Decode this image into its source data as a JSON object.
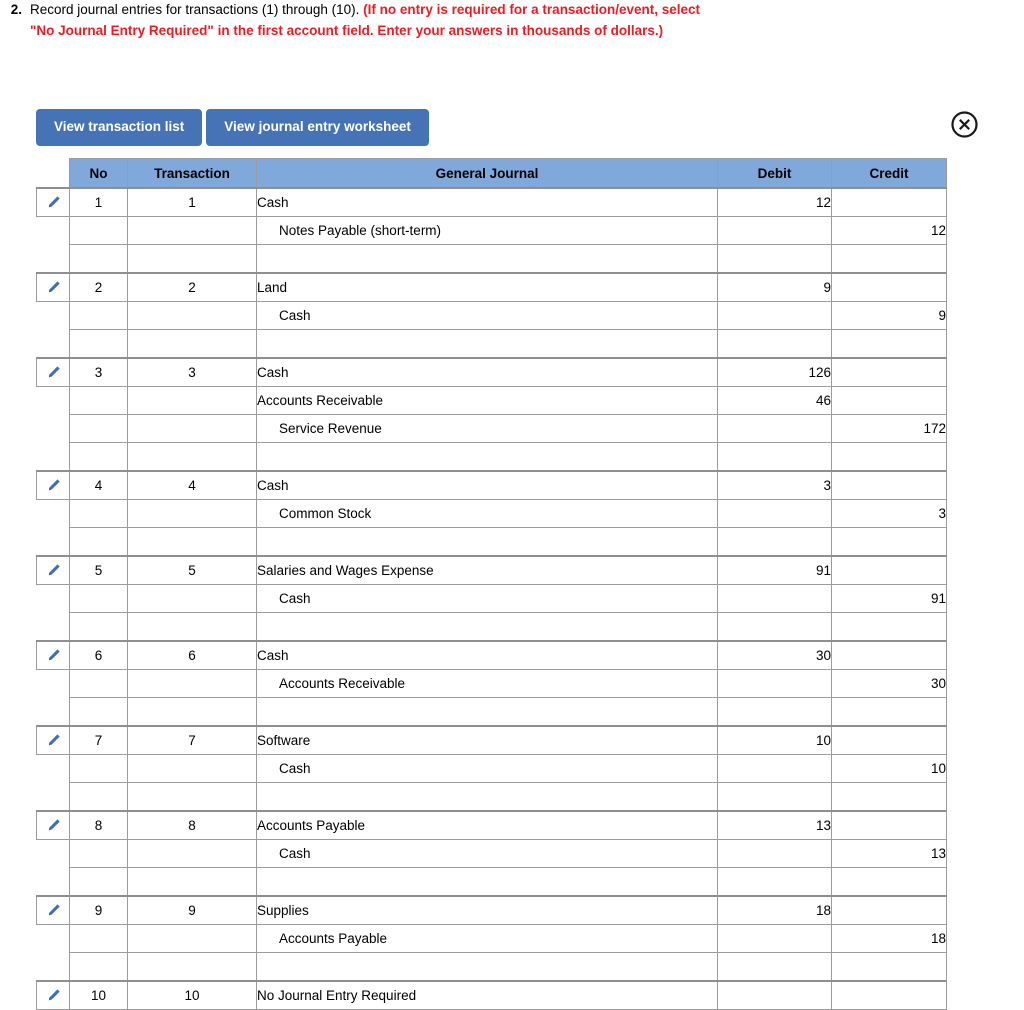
{
  "question": {
    "number": "2.",
    "lead": "Record journal entries for transactions (1) through (10). ",
    "emphasis": "(If no entry is required for a transaction/event, select \"No Journal Entry Required\" in the first account field. Enter your answers in thousands of dollars.)"
  },
  "toolbar": {
    "view_transaction_list_label": "View transaction list",
    "view_journal_entry_worksheet_label": "View journal entry worksheet",
    "close_icon": "close-circle-icon"
  },
  "colors": {
    "button_blue": "#4573b5",
    "header_blue": "#81a8db",
    "emphasis_red": "#ec1c24",
    "pencil_blue": "#3d6fb4",
    "grid_gray": "#9c9c9c"
  },
  "table": {
    "columns": [
      "No",
      "Transaction",
      "General Journal",
      "Debit",
      "Credit"
    ],
    "edit_icon": "pencil-icon",
    "entries": [
      {
        "no": "1",
        "transaction": "1",
        "lines": [
          {
            "account": "Cash",
            "indent": false,
            "debit": "12",
            "credit": ""
          },
          {
            "account": "Notes Payable (short-term)",
            "indent": true,
            "debit": "",
            "credit": "12"
          }
        ]
      },
      {
        "no": "2",
        "transaction": "2",
        "lines": [
          {
            "account": "Land",
            "indent": false,
            "debit": "9",
            "credit": ""
          },
          {
            "account": "Cash",
            "indent": true,
            "debit": "",
            "credit": "9"
          }
        ]
      },
      {
        "no": "3",
        "transaction": "3",
        "lines": [
          {
            "account": "Cash",
            "indent": false,
            "debit": "126",
            "credit": ""
          },
          {
            "account": "Accounts Receivable",
            "indent": false,
            "debit": "46",
            "credit": ""
          },
          {
            "account": "Service Revenue",
            "indent": true,
            "debit": "",
            "credit": "172"
          }
        ]
      },
      {
        "no": "4",
        "transaction": "4",
        "lines": [
          {
            "account": "Cash",
            "indent": false,
            "debit": "3",
            "credit": ""
          },
          {
            "account": "Common Stock",
            "indent": true,
            "debit": "",
            "credit": "3"
          }
        ]
      },
      {
        "no": "5",
        "transaction": "5",
        "lines": [
          {
            "account": "Salaries and Wages Expense",
            "indent": false,
            "debit": "91",
            "credit": ""
          },
          {
            "account": "Cash",
            "indent": true,
            "debit": "",
            "credit": "91"
          }
        ]
      },
      {
        "no": "6",
        "transaction": "6",
        "lines": [
          {
            "account": "Cash",
            "indent": false,
            "debit": "30",
            "credit": ""
          },
          {
            "account": "Accounts Receivable",
            "indent": true,
            "debit": "",
            "credit": "30"
          }
        ]
      },
      {
        "no": "7",
        "transaction": "7",
        "lines": [
          {
            "account": "Software",
            "indent": false,
            "debit": "10",
            "credit": ""
          },
          {
            "account": "Cash",
            "indent": true,
            "debit": "",
            "credit": "10"
          }
        ]
      },
      {
        "no": "8",
        "transaction": "8",
        "lines": [
          {
            "account": "Accounts Payable",
            "indent": false,
            "debit": "13",
            "credit": ""
          },
          {
            "account": "Cash",
            "indent": true,
            "debit": "",
            "credit": "13"
          }
        ]
      },
      {
        "no": "9",
        "transaction": "9",
        "lines": [
          {
            "account": "Supplies",
            "indent": false,
            "debit": "18",
            "credit": ""
          },
          {
            "account": "Accounts Payable",
            "indent": true,
            "debit": "",
            "credit": "18"
          }
        ]
      },
      {
        "no": "10",
        "transaction": "10",
        "lines": [
          {
            "account": "No Journal Entry Required",
            "indent": false,
            "debit": "",
            "credit": ""
          }
        ]
      }
    ]
  }
}
